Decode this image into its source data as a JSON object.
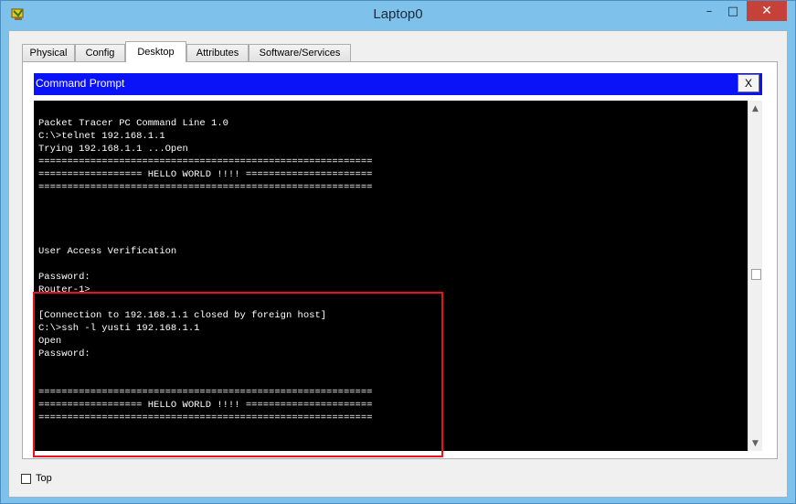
{
  "window": {
    "title": "Laptop0",
    "controls": {
      "minimize": "–",
      "maximize": "□",
      "close": "✕"
    }
  },
  "tabs": [
    {
      "label": "Physical",
      "active": false
    },
    {
      "label": "Config",
      "active": false
    },
    {
      "label": "Desktop",
      "active": true
    },
    {
      "label": "Attributes",
      "active": false
    },
    {
      "label": "Software/Services",
      "active": false
    }
  ],
  "command_prompt": {
    "title": "Command Prompt",
    "close_label": "X",
    "lines": [
      "Packet Tracer PC Command Line 1.0",
      "C:\\>telnet 192.168.1.1",
      "Trying 192.168.1.1 ...Open",
      "==========================================================",
      "================== HELLO WORLD !!!! ======================",
      "==========================================================",
      "",
      "",
      "",
      "",
      "User Access Verification",
      "",
      "Password:",
      "Router-1>",
      "",
      "[Connection to 192.168.1.1 closed by foreign host]",
      "C:\\>ssh -l yusti 192.168.1.1",
      "Open",
      "Password:",
      "",
      "",
      "==========================================================",
      "================== HELLO WORLD !!!! ======================",
      "==========================================================",
      "",
      "",
      ""
    ],
    "prompt": "Router-1>"
  },
  "bottom": {
    "top_checkbox_label": "Top",
    "top_checked": false
  },
  "colors": {
    "title_bar": "#7ec1ea",
    "cmd_header": "#0a12f7",
    "terminal_bg": "#000000",
    "terminal_fg": "#ffffff",
    "highlight": "#e81123",
    "close_button": "#c7413b"
  }
}
